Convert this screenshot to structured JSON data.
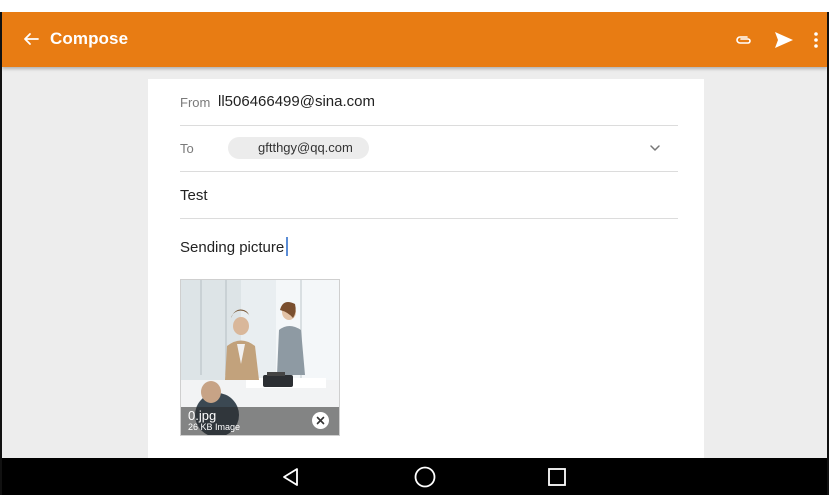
{
  "appbar": {
    "title": "Compose",
    "color": "#e87c13",
    "back_icon": "arrow-back-icon",
    "actions": [
      "attach-icon",
      "send-icon",
      "more-vertical-icon"
    ]
  },
  "compose": {
    "from_label": "From",
    "from_value": "ll506466499@sina.com",
    "to_label": "To",
    "to_chip": "gftthgy@qq.com",
    "subject": "Test",
    "body": "Sending picture"
  },
  "attachment": {
    "filename": "0.jpg",
    "meta": "26 KB Image",
    "remove_icon": "close-circle-icon"
  },
  "navbar": {
    "buttons": [
      "back-triangle-icon",
      "home-circle-icon",
      "recents-square-icon"
    ]
  }
}
